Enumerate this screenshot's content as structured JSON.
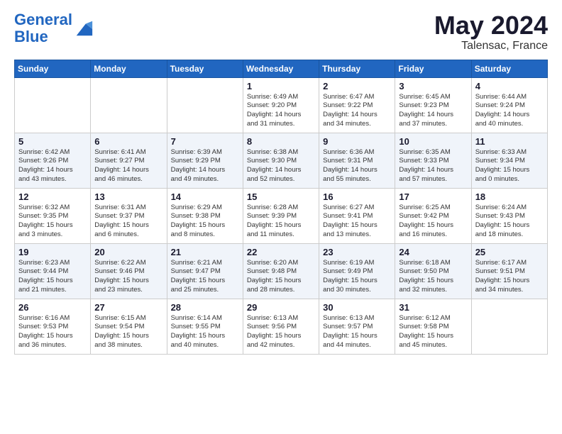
{
  "header": {
    "logo_line1": "General",
    "logo_line2": "Blue",
    "month": "May 2024",
    "location": "Talensac, France"
  },
  "days_of_week": [
    "Sunday",
    "Monday",
    "Tuesday",
    "Wednesday",
    "Thursday",
    "Friday",
    "Saturday"
  ],
  "weeks": [
    [
      {
        "num": "",
        "info": ""
      },
      {
        "num": "",
        "info": ""
      },
      {
        "num": "",
        "info": ""
      },
      {
        "num": "1",
        "info": "Sunrise: 6:49 AM\nSunset: 9:20 PM\nDaylight: 14 hours\nand 31 minutes."
      },
      {
        "num": "2",
        "info": "Sunrise: 6:47 AM\nSunset: 9:22 PM\nDaylight: 14 hours\nand 34 minutes."
      },
      {
        "num": "3",
        "info": "Sunrise: 6:45 AM\nSunset: 9:23 PM\nDaylight: 14 hours\nand 37 minutes."
      },
      {
        "num": "4",
        "info": "Sunrise: 6:44 AM\nSunset: 9:24 PM\nDaylight: 14 hours\nand 40 minutes."
      }
    ],
    [
      {
        "num": "5",
        "info": "Sunrise: 6:42 AM\nSunset: 9:26 PM\nDaylight: 14 hours\nand 43 minutes."
      },
      {
        "num": "6",
        "info": "Sunrise: 6:41 AM\nSunset: 9:27 PM\nDaylight: 14 hours\nand 46 minutes."
      },
      {
        "num": "7",
        "info": "Sunrise: 6:39 AM\nSunset: 9:29 PM\nDaylight: 14 hours\nand 49 minutes."
      },
      {
        "num": "8",
        "info": "Sunrise: 6:38 AM\nSunset: 9:30 PM\nDaylight: 14 hours\nand 52 minutes."
      },
      {
        "num": "9",
        "info": "Sunrise: 6:36 AM\nSunset: 9:31 PM\nDaylight: 14 hours\nand 55 minutes."
      },
      {
        "num": "10",
        "info": "Sunrise: 6:35 AM\nSunset: 9:33 PM\nDaylight: 14 hours\nand 57 minutes."
      },
      {
        "num": "11",
        "info": "Sunrise: 6:33 AM\nSunset: 9:34 PM\nDaylight: 15 hours\nand 0 minutes."
      }
    ],
    [
      {
        "num": "12",
        "info": "Sunrise: 6:32 AM\nSunset: 9:35 PM\nDaylight: 15 hours\nand 3 minutes."
      },
      {
        "num": "13",
        "info": "Sunrise: 6:31 AM\nSunset: 9:37 PM\nDaylight: 15 hours\nand 6 minutes."
      },
      {
        "num": "14",
        "info": "Sunrise: 6:29 AM\nSunset: 9:38 PM\nDaylight: 15 hours\nand 8 minutes."
      },
      {
        "num": "15",
        "info": "Sunrise: 6:28 AM\nSunset: 9:39 PM\nDaylight: 15 hours\nand 11 minutes."
      },
      {
        "num": "16",
        "info": "Sunrise: 6:27 AM\nSunset: 9:41 PM\nDaylight: 15 hours\nand 13 minutes."
      },
      {
        "num": "17",
        "info": "Sunrise: 6:25 AM\nSunset: 9:42 PM\nDaylight: 15 hours\nand 16 minutes."
      },
      {
        "num": "18",
        "info": "Sunrise: 6:24 AM\nSunset: 9:43 PM\nDaylight: 15 hours\nand 18 minutes."
      }
    ],
    [
      {
        "num": "19",
        "info": "Sunrise: 6:23 AM\nSunset: 9:44 PM\nDaylight: 15 hours\nand 21 minutes."
      },
      {
        "num": "20",
        "info": "Sunrise: 6:22 AM\nSunset: 9:46 PM\nDaylight: 15 hours\nand 23 minutes."
      },
      {
        "num": "21",
        "info": "Sunrise: 6:21 AM\nSunset: 9:47 PM\nDaylight: 15 hours\nand 25 minutes."
      },
      {
        "num": "22",
        "info": "Sunrise: 6:20 AM\nSunset: 9:48 PM\nDaylight: 15 hours\nand 28 minutes."
      },
      {
        "num": "23",
        "info": "Sunrise: 6:19 AM\nSunset: 9:49 PM\nDaylight: 15 hours\nand 30 minutes."
      },
      {
        "num": "24",
        "info": "Sunrise: 6:18 AM\nSunset: 9:50 PM\nDaylight: 15 hours\nand 32 minutes."
      },
      {
        "num": "25",
        "info": "Sunrise: 6:17 AM\nSunset: 9:51 PM\nDaylight: 15 hours\nand 34 minutes."
      }
    ],
    [
      {
        "num": "26",
        "info": "Sunrise: 6:16 AM\nSunset: 9:53 PM\nDaylight: 15 hours\nand 36 minutes."
      },
      {
        "num": "27",
        "info": "Sunrise: 6:15 AM\nSunset: 9:54 PM\nDaylight: 15 hours\nand 38 minutes."
      },
      {
        "num": "28",
        "info": "Sunrise: 6:14 AM\nSunset: 9:55 PM\nDaylight: 15 hours\nand 40 minutes."
      },
      {
        "num": "29",
        "info": "Sunrise: 6:13 AM\nSunset: 9:56 PM\nDaylight: 15 hours\nand 42 minutes."
      },
      {
        "num": "30",
        "info": "Sunrise: 6:13 AM\nSunset: 9:57 PM\nDaylight: 15 hours\nand 44 minutes."
      },
      {
        "num": "31",
        "info": "Sunrise: 6:12 AM\nSunset: 9:58 PM\nDaylight: 15 hours\nand 45 minutes."
      },
      {
        "num": "",
        "info": ""
      }
    ]
  ]
}
